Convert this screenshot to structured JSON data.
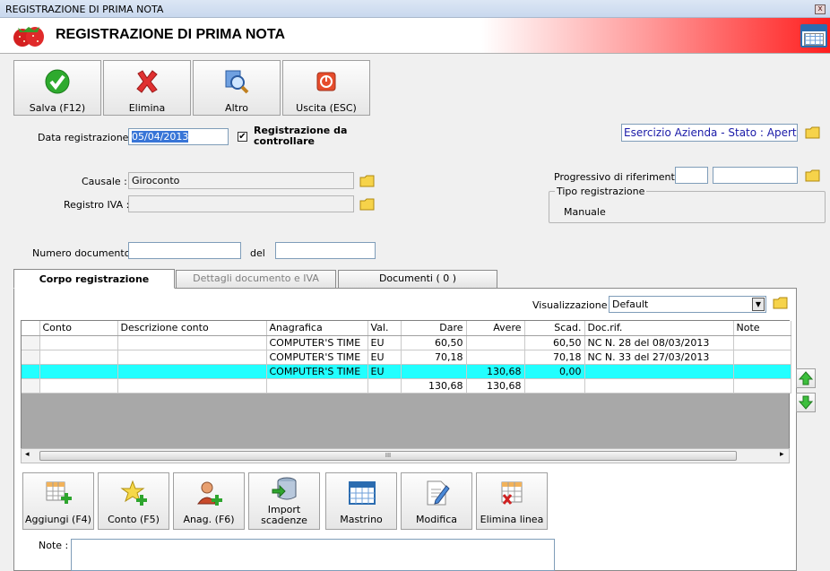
{
  "window": {
    "title": "REGISTRAZIONE DI PRIMA NOTA",
    "close_glyph": "x"
  },
  "header": {
    "title": "REGISTRAZIONE DI PRIMA NOTA"
  },
  "toolbar": {
    "save": "Salva (F12)",
    "delete": "Elimina",
    "other": "Altro",
    "exit": "Uscita (ESC)"
  },
  "form": {
    "data_label": "Data registrazione :",
    "data_value": "05/04/2013",
    "check_label": "Registrazione da controllare",
    "check_mark": "✔",
    "causale_label": "Causale :",
    "causale_value": "Giroconto",
    "registro_label": "Registro IVA :",
    "registro_value": "",
    "numero_label": "Numero documento :",
    "numero_value": "",
    "del_label": "del",
    "del_value": "",
    "esercizio": "Esercizio Azienda - Stato : Aperto",
    "progressivo_label": "Progressivo di riferimento :",
    "progressivo_a": "",
    "progressivo_b": "",
    "tipo_legend": "Tipo registrazione",
    "tipo_value": "Manuale"
  },
  "tabs": [
    "Corpo registrazione",
    "Dettagli documento e IVA",
    "Documenti ( 0 )"
  ],
  "view": {
    "label": "Visualizzazione :",
    "value": "Default",
    "arrow": "▼"
  },
  "grid": {
    "columns": [
      "Conto",
      "Descrizione conto",
      "Anagrafica",
      "Val.",
      "Dare",
      "Avere",
      "Scad.",
      "Doc.rif.",
      "Note"
    ],
    "rows": [
      [
        "",
        "",
        "COMPUTER'S TIME",
        "EU",
        "60,50",
        "",
        "60,50",
        "NC N. 28 del 08/03/2013",
        ""
      ],
      [
        "",
        "",
        "COMPUTER'S TIME",
        "EU",
        "70,18",
        "",
        "70,18",
        "NC N. 33 del 27/03/2013",
        ""
      ],
      [
        "",
        "",
        "COMPUTER'S TIME",
        "EU",
        "",
        "130,68",
        "0,00",
        "",
        ""
      ],
      [
        "",
        "",
        "",
        "",
        "130,68",
        "130,68",
        "",
        "",
        ""
      ]
    ],
    "scroll_mark": "III"
  },
  "bottom_buttons": {
    "add": "Aggiungi (F4)",
    "conto": "Conto (F5)",
    "anag": "Anag. (F6)",
    "import": "Import scadenze",
    "mastrino": "Mastrino",
    "modifica": "Modifica",
    "elimina_linea": "Elimina linea"
  },
  "note": {
    "label": "Note :",
    "value": ""
  },
  "colors": {
    "accent_red": "#ff1e1e",
    "selected_row": "#22ffff",
    "link_blue": "#1a1aa8"
  }
}
